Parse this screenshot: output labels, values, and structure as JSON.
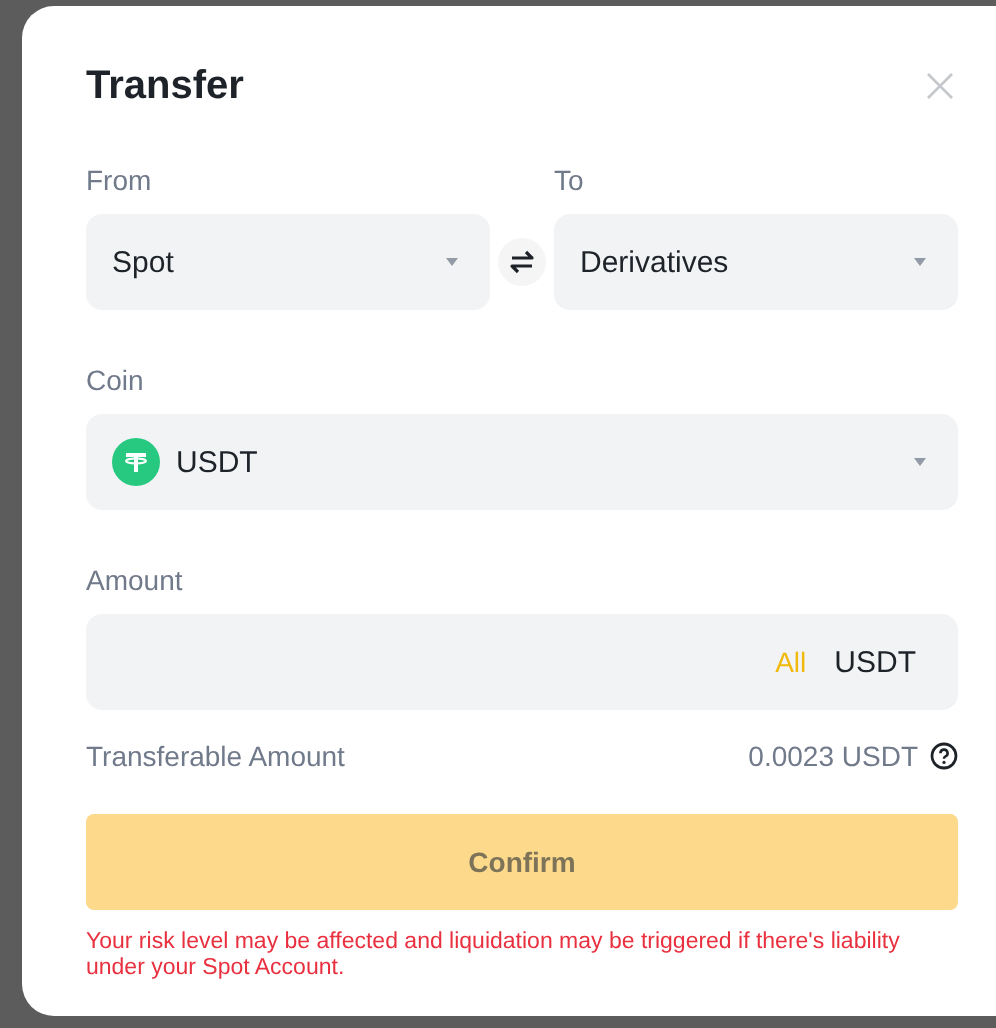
{
  "dialog": {
    "title": "Transfer"
  },
  "from": {
    "label": "From",
    "value": "Spot"
  },
  "to": {
    "label": "To",
    "value": "Derivatives"
  },
  "coin": {
    "label": "Coin",
    "value": "USDT"
  },
  "amount": {
    "label": "Amount",
    "all": "All",
    "unit": "USDT"
  },
  "transferable": {
    "label": "Transferable Amount",
    "value": "0.0023 USDT"
  },
  "confirm": {
    "label": "Confirm",
    "disabled": true
  },
  "warning": "Your risk level may be affected and liquidation may be triggered if there's liability under your Spot Account."
}
